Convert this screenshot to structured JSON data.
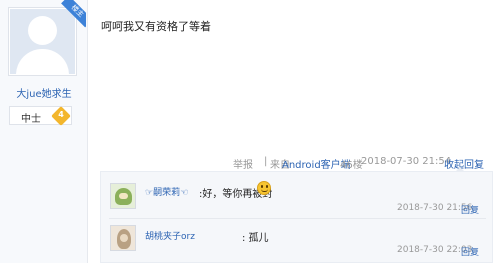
{
  "author": {
    "badge": "楼主",
    "name": "大jue她求生",
    "level_title": "中士",
    "level_num": "4",
    "avatar_icon": "default-avatar-icon",
    "badge_color": "#3d82d8"
  },
  "post": {
    "content": "呵呵我又有资格了等着",
    "report_label": "举报",
    "separator": "|",
    "from_label": "来自",
    "client": "Android客户端",
    "floor": "46楼",
    "time": "2018-07-30 21:54",
    "reply_toggle": "收起回复"
  },
  "replies": [
    {
      "user": "☞嗣荣莉☜",
      "text": ":好，等你再被封",
      "emoji": "smiley-icon",
      "time": "2018-7-30 21:56",
      "reply_label": "回复"
    },
    {
      "user": "胡桃夹子orz",
      "text": ": 孤儿",
      "time": "2018-7-30 22:03",
      "reply_label": "回复"
    }
  ],
  "colors": {
    "link": "#2d64b3",
    "meta": "#999999",
    "level_gem": "#f3b62c"
  }
}
